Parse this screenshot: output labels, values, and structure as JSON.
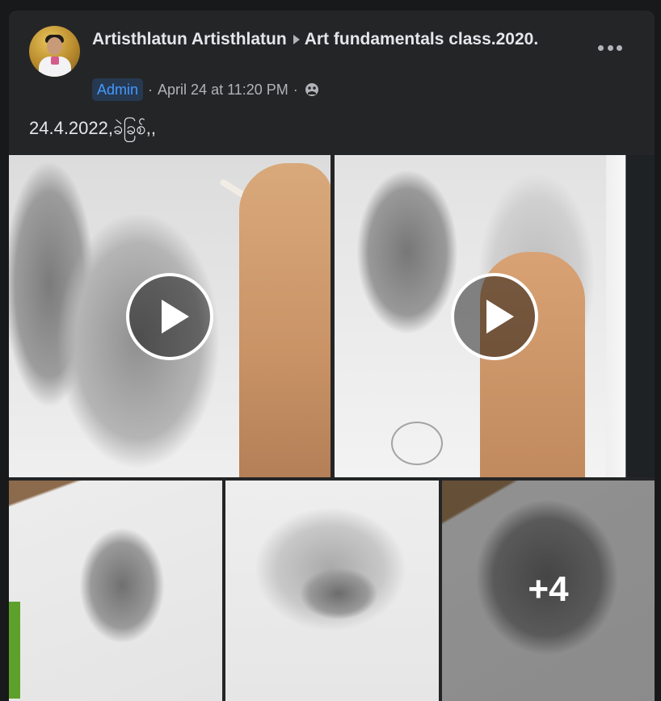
{
  "post": {
    "author": "Artisthlatun Artisthlatun",
    "group": "Art fundamentals class.2020.",
    "role_badge": "Admin",
    "separator": "·",
    "timestamp": "April 24 at 11:20 PM",
    "audience_icon": "group-audience-icon",
    "text": "24.4.2022,ခဲခြစ်,,"
  },
  "media": {
    "videos": [
      {
        "icon": "play-icon"
      },
      {
        "icon": "play-icon"
      }
    ],
    "photos": [
      {
        "icon": "photo"
      },
      {
        "icon": "photo"
      },
      {
        "more_label": "+4"
      }
    ]
  },
  "colors": {
    "background": "#18191a",
    "card": "#242526",
    "text_primary": "#e4e6eb",
    "text_secondary": "#b0b3b8",
    "badge_bg": "#263951",
    "badge_text": "#4599ff"
  }
}
